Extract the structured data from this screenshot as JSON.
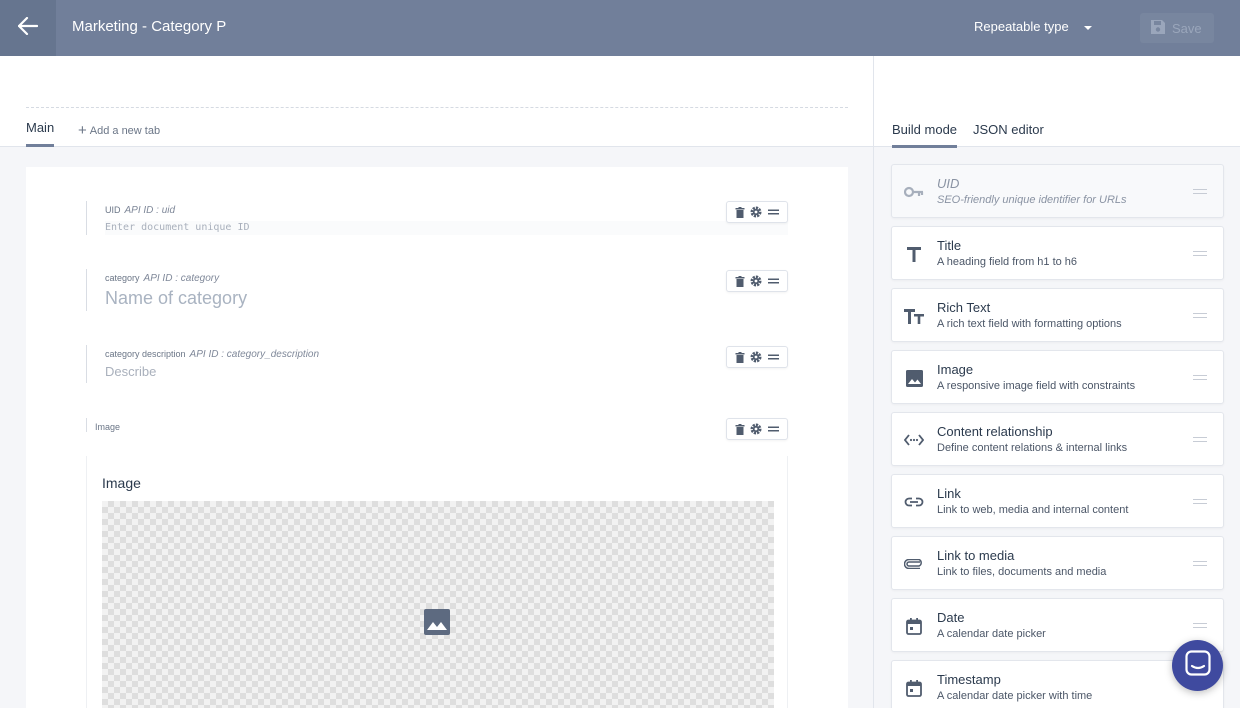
{
  "header": {
    "title": "Marketing - Category P",
    "type_label": "Repeatable type",
    "save_label": "Save"
  },
  "editor_tabs": {
    "main": "Main",
    "add_tab": "Add a new tab"
  },
  "fields": [
    {
      "label": "UID",
      "api_id": "API ID : uid",
      "placeholder": "Enter document unique ID"
    },
    {
      "label": "category",
      "api_id": "API ID : category",
      "placeholder": "Name of category"
    },
    {
      "label": "category description",
      "api_id": "API ID : category_description",
      "placeholder": "Describe"
    },
    {
      "label": "Image",
      "card_title": "Image"
    }
  ],
  "sidebar": {
    "tabs": [
      "Build mode",
      "JSON editor"
    ],
    "widgets": [
      {
        "title": "UID",
        "desc": "SEO-friendly unique identifier for URLs",
        "icon": "key-icon"
      },
      {
        "title": "Title",
        "desc": "A heading field from h1 to h6",
        "icon": "text-t-icon"
      },
      {
        "title": "Rich Text",
        "desc": "A rich text field with formatting options",
        "icon": "rich-text-icon"
      },
      {
        "title": "Image",
        "desc": "A responsive image field with constraints",
        "icon": "image-icon"
      },
      {
        "title": "Content relationship",
        "desc": "Define content relations & internal links",
        "icon": "relationship-icon"
      },
      {
        "title": "Link",
        "desc": "Link to web, media and internal content",
        "icon": "link-icon"
      },
      {
        "title": "Link to media",
        "desc": "Link to files, documents and media",
        "icon": "attachment-icon"
      },
      {
        "title": "Date",
        "desc": "A calendar date picker",
        "icon": "calendar-icon"
      },
      {
        "title": "Timestamp",
        "desc": "A calendar date picker with time",
        "icon": "calendar-icon"
      }
    ]
  },
  "colors": {
    "header": "#717f9a",
    "accent": "#3f4a9f",
    "background": "#f5f6f9"
  }
}
